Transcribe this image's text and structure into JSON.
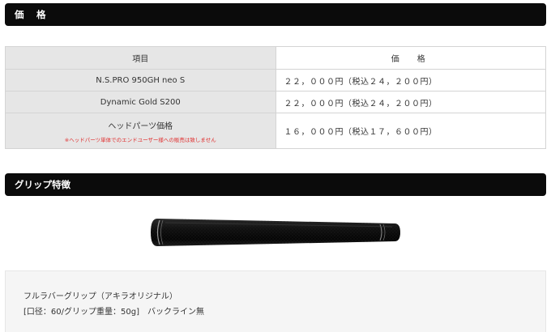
{
  "price_section": {
    "title": "価　格",
    "table": {
      "headers": {
        "item": "項目",
        "price": "価　格"
      },
      "rows": [
        {
          "item": "N.S.PRO 950GH neo S",
          "price": "２２，０００円（税込２４，２００円）"
        },
        {
          "item": "Dynamic Gold S200",
          "price": "２２，０００円（税込２４，２００円）"
        },
        {
          "item": "ヘッドパーツ価格",
          "note": "※ヘッドパーツ単体でのエンドユーザー様への販売は致しません",
          "price": "１６，０００円（税込１７，６００円）"
        }
      ]
    }
  },
  "grip_section": {
    "title": "グリップ特徴",
    "description": {
      "line1": "フルラバーグリップ（アキラオリジナル）",
      "line2": "[口径：60/グリップ重量：50g]　バックライン無"
    }
  },
  "colors": {
    "header_bg": "#0b0b0b",
    "table_label_bg": "#e6e6e6",
    "note_red": "#e03030",
    "description_bg": "#f5f5f5"
  }
}
